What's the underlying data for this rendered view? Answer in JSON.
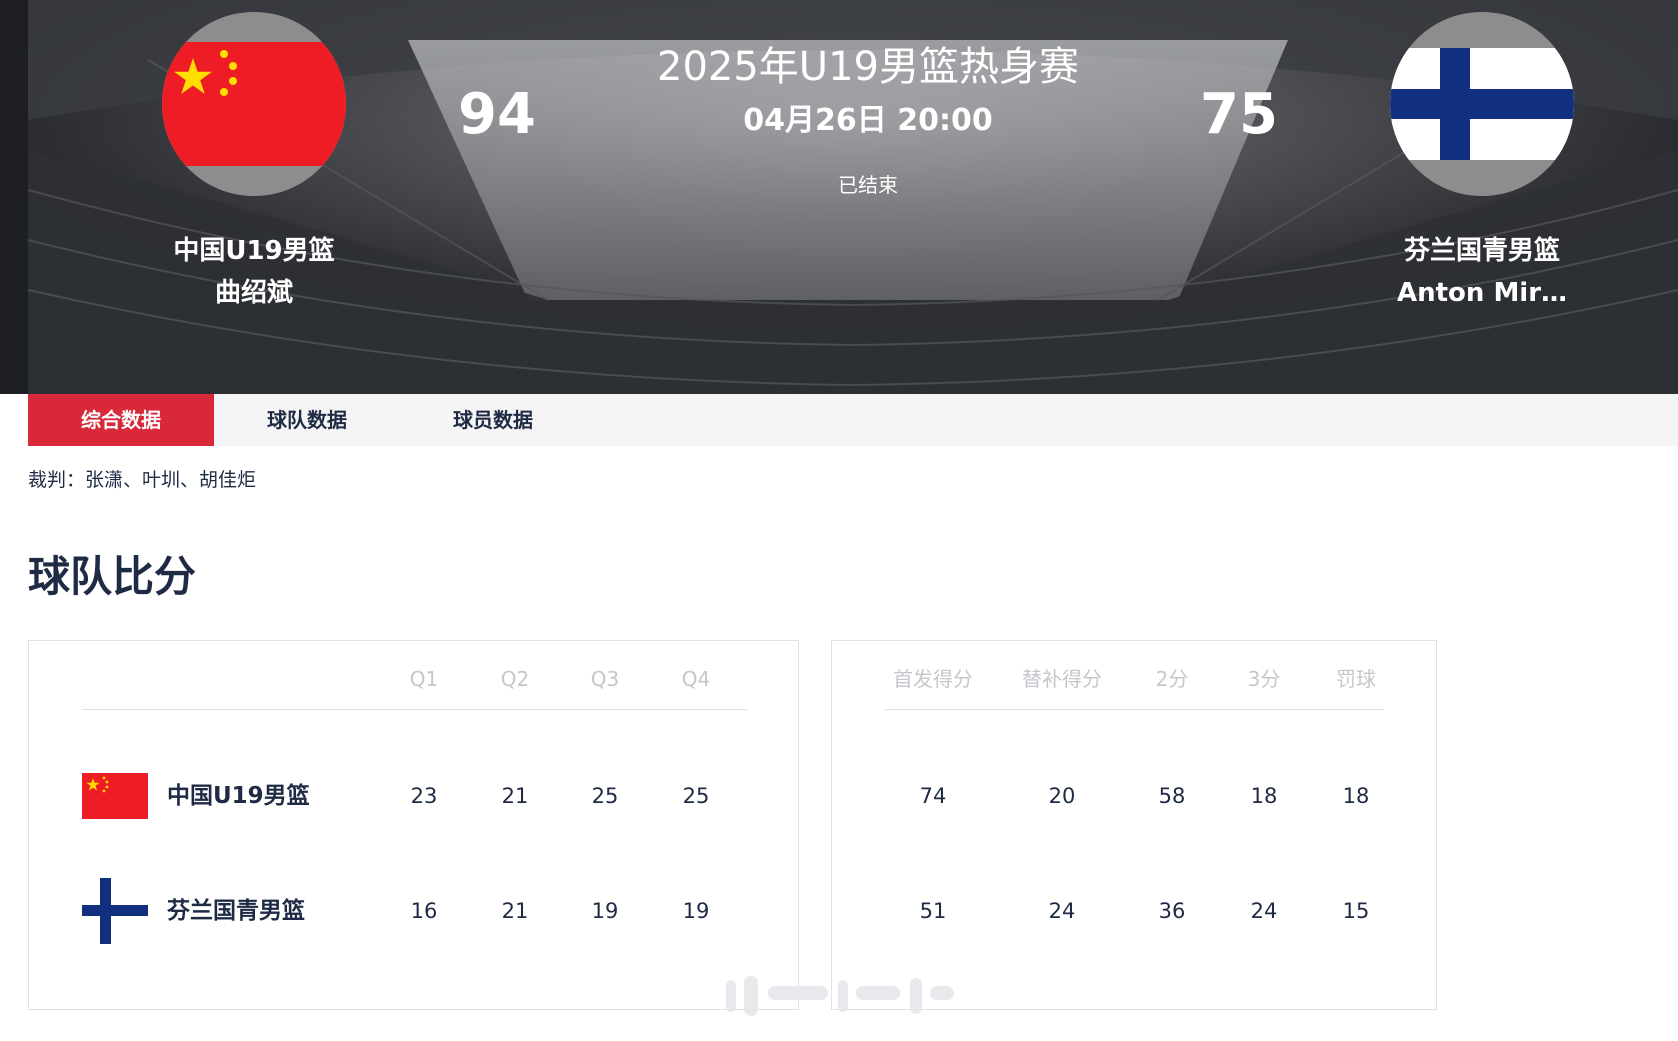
{
  "match": {
    "title": "2025年U19男篮热身赛",
    "datetime": "04月26日 20:00",
    "status": "已结束"
  },
  "home": {
    "name": "中国U19男篮",
    "coach": "曲绍斌",
    "score": "94",
    "flag_icon": "china-flag-icon"
  },
  "away": {
    "name": "芬兰国青男篮",
    "coach": "Anton Mir…",
    "score": "75",
    "flag_icon": "finland-flag-icon"
  },
  "tabs": [
    {
      "label": "综合数据",
      "active": true
    },
    {
      "label": "球队数据",
      "active": false
    },
    {
      "label": "球员数据",
      "active": false
    }
  ],
  "referees": "裁判：张潇、叶圳、胡佳炬",
  "section_title": "球队比分",
  "quarter_table": {
    "headers": [
      "Q1",
      "Q2",
      "Q3",
      "Q4"
    ],
    "rows": [
      {
        "team": "中国U19男篮",
        "values": [
          "23",
          "21",
          "25",
          "25"
        ]
      },
      {
        "team": "芬兰国青男篮",
        "values": [
          "16",
          "21",
          "19",
          "19"
        ]
      }
    ]
  },
  "stats_table": {
    "headers": [
      "首发得分",
      "替补得分",
      "2分",
      "3分",
      "罚球"
    ],
    "rows": [
      {
        "values": [
          "74",
          "20",
          "58",
          "18",
          "18"
        ]
      },
      {
        "values": [
          "51",
          "24",
          "36",
          "24",
          "15"
        ]
      }
    ]
  },
  "colors": {
    "accent": "#d8283a",
    "text": "#1f2a44",
    "china_red": "#ee1c25",
    "china_yellow": "#ffde00",
    "finland_blue": "#102f7e"
  }
}
